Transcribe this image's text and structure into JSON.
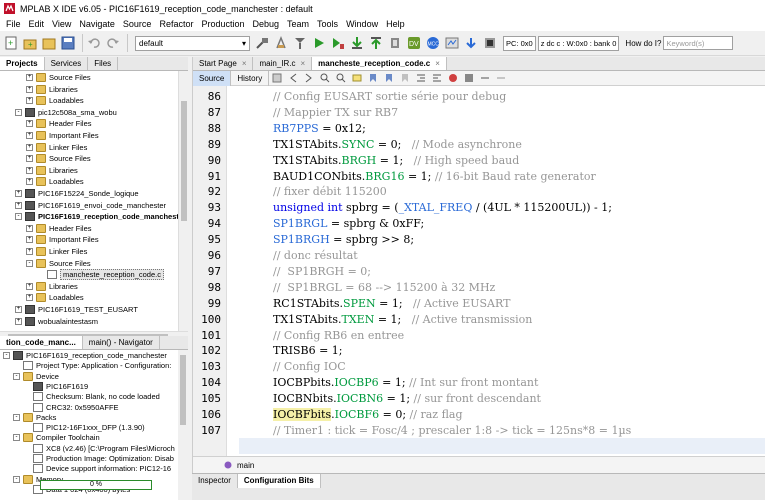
{
  "window": {
    "title": "MPLAB X IDE v6.05 - PIC16F1619_reception_code_manchester : default"
  },
  "menu": [
    "File",
    "Edit",
    "View",
    "Navigate",
    "Source",
    "Refactor",
    "Production",
    "Debug",
    "Team",
    "Tools",
    "Window",
    "Help"
  ],
  "toolbar": {
    "config_value": "default",
    "pc_status": "PC: 0x0",
    "bank_status": "z dc c  : W:0x0 : bank 0",
    "help_label": "How do I?",
    "keyword_placeholder": "Keyword(s)"
  },
  "left_tabs": [
    "Projects",
    "Services",
    "Files"
  ],
  "project_tree": [
    {
      "label": "Source Files",
      "indent": 2,
      "icon": "folder",
      "exp": "+"
    },
    {
      "label": "Libraries",
      "indent": 2,
      "icon": "folder",
      "exp": "+"
    },
    {
      "label": "Loadables",
      "indent": 2,
      "icon": "folder",
      "exp": "+"
    },
    {
      "label": "pic12c508a_sma_wobu",
      "indent": 1,
      "icon": "chip",
      "exp": "-"
    },
    {
      "label": "Header Files",
      "indent": 2,
      "icon": "folder",
      "exp": "+"
    },
    {
      "label": "Important Files",
      "indent": 2,
      "icon": "folder",
      "exp": "+"
    },
    {
      "label": "Linker Files",
      "indent": 2,
      "icon": "folder",
      "exp": "+"
    },
    {
      "label": "Source Files",
      "indent": 2,
      "icon": "folder",
      "exp": "+"
    },
    {
      "label": "Libraries",
      "indent": 2,
      "icon": "folder",
      "exp": "+"
    },
    {
      "label": "Loadables",
      "indent": 2,
      "icon": "folder",
      "exp": "+"
    },
    {
      "label": "PIC16F15224_Sonde_logique",
      "indent": 1,
      "icon": "chip",
      "exp": "+"
    },
    {
      "label": "PIC16F1619_envoi_code_manchester",
      "indent": 1,
      "icon": "chip",
      "exp": "+"
    },
    {
      "label": "PIC16F1619_reception_code_manchester",
      "indent": 1,
      "icon": "chip",
      "exp": "-",
      "bold": true
    },
    {
      "label": "Header Files",
      "indent": 2,
      "icon": "folder",
      "exp": "+"
    },
    {
      "label": "Important Files",
      "indent": 2,
      "icon": "folder",
      "exp": "+"
    },
    {
      "label": "Linker Files",
      "indent": 2,
      "icon": "folder",
      "exp": "+"
    },
    {
      "label": "Source Files",
      "indent": 2,
      "icon": "folder",
      "exp": "-"
    },
    {
      "label": "mancheste_reception_code.c",
      "indent": 3,
      "icon": "file",
      "exp": "",
      "selected": true
    },
    {
      "label": "Libraries",
      "indent": 2,
      "icon": "folder",
      "exp": "+"
    },
    {
      "label": "Loadables",
      "indent": 2,
      "icon": "folder",
      "exp": "+"
    },
    {
      "label": "PIC16F1619_TEST_EUSART",
      "indent": 1,
      "icon": "chip",
      "exp": "+"
    },
    {
      "label": "wobualaintestasm",
      "indent": 1,
      "icon": "chip",
      "exp": "+"
    }
  ],
  "nav_tabs": [
    "tion_code_manc...",
    "main() - Navigator"
  ],
  "nav_tree": [
    {
      "label": "PIC16F1619_reception_code_manchester",
      "indent": 0,
      "exp": "-",
      "icon": "chip"
    },
    {
      "label": "Project Type: Application - Configuration:",
      "indent": 1,
      "exp": "",
      "icon": "file"
    },
    {
      "label": "Device",
      "indent": 1,
      "exp": "-",
      "icon": "folder"
    },
    {
      "label": "PIC16F1619",
      "indent": 2,
      "exp": "",
      "icon": "chip"
    },
    {
      "label": "Checksum: Blank, no code loaded",
      "indent": 2,
      "exp": "",
      "icon": "file"
    },
    {
      "label": "CRC32: 0x5950AFFE",
      "indent": 2,
      "exp": "",
      "icon": "file"
    },
    {
      "label": "Packs",
      "indent": 1,
      "exp": "-",
      "icon": "folder"
    },
    {
      "label": "PIC12-16F1xxx_DFP (1.3.90)",
      "indent": 2,
      "exp": "",
      "icon": "file"
    },
    {
      "label": "Compiler Toolchain",
      "indent": 1,
      "exp": "-",
      "icon": "folder"
    },
    {
      "label": "XC8 (v2.46) [C:\\Program Files\\Microch",
      "indent": 2,
      "exp": "",
      "icon": "file"
    },
    {
      "label": "Production Image: Optimization: Disab",
      "indent": 2,
      "exp": "",
      "icon": "file"
    },
    {
      "label": "Device support information: PIC12-16",
      "indent": 2,
      "exp": "",
      "icon": "file"
    },
    {
      "label": "Memory",
      "indent": 1,
      "exp": "-",
      "icon": "folder"
    },
    {
      "label": "Data 1 024 (0x400) bytes",
      "indent": 2,
      "exp": "",
      "icon": "file"
    }
  ],
  "memory_usage": {
    "label": "0 %",
    "fraction": 0.0
  },
  "editor_tabs": [
    "Start Page",
    "main_IR.c",
    "mancheste_reception_code.c"
  ],
  "editor_toolbar": {
    "source": "Source",
    "history": "History"
  },
  "code_lines": [
    {
      "n": "86",
      "parts": [
        [
          "cm",
          "// Config EUSART sortie série pour debug"
        ]
      ]
    },
    {
      "n": "87",
      "parts": [
        [
          "cm",
          "// Mappier TX sur RB7"
        ]
      ]
    },
    {
      "n": "88",
      "parts": [
        [
          "mac",
          "RB7PPS"
        ],
        [
          "",
          " = 0x12;"
        ]
      ]
    },
    {
      "n": "89",
      "parts": [
        [
          "",
          "TX1STAbits."
        ],
        [
          "fld",
          "SYNC"
        ],
        [
          "",
          " = 0;   "
        ],
        [
          "cm",
          "// Mode asynchrone"
        ]
      ]
    },
    {
      "n": "90",
      "parts": [
        [
          "",
          "TX1STAbits."
        ],
        [
          "fld",
          "BRGH"
        ],
        [
          "",
          " = 1;   "
        ],
        [
          "cm",
          "// High speed baud"
        ]
      ]
    },
    {
      "n": "91",
      "parts": [
        [
          "",
          "BAUD1CONbits."
        ],
        [
          "fld",
          "BRG16"
        ],
        [
          "",
          " = 1; "
        ],
        [
          "cm",
          "// 16-bit Baud rate generator"
        ]
      ]
    },
    {
      "n": "92",
      "parts": [
        [
          "cm",
          "// fixer débit 115200"
        ]
      ]
    },
    {
      "n": "93",
      "parts": [
        [
          "kw",
          "unsigned int"
        ],
        [
          "",
          " spbrg = ("
        ],
        [
          "mac",
          "_XTAL_FREQ"
        ],
        [
          "",
          " / (4UL * 115200UL)) - 1;"
        ]
      ]
    },
    {
      "n": "94",
      "parts": [
        [
          "mac",
          "SP1BRGL"
        ],
        [
          "",
          " = spbrg & 0xFF;"
        ]
      ]
    },
    {
      "n": "95",
      "parts": [
        [
          "mac",
          "SP1BRGH"
        ],
        [
          "",
          " = spbrg >> 8;"
        ]
      ]
    },
    {
      "n": "96",
      "parts": [
        [
          "cm",
          "// donc résultat"
        ]
      ]
    },
    {
      "n": "97",
      "parts": [
        [
          "cm",
          "//  SP1BRGH = 0;"
        ]
      ]
    },
    {
      "n": "98",
      "parts": [
        [
          "cm",
          "//  SP1BRGL = 68 --> 115200 à 32 MHz"
        ]
      ]
    },
    {
      "n": "99",
      "parts": [
        [
          "",
          "RC1STAbits."
        ],
        [
          "fld",
          "SPEN"
        ],
        [
          "",
          " = 1;   "
        ],
        [
          "cm",
          "// Active EUSART"
        ]
      ]
    },
    {
      "n": "100",
      "parts": [
        [
          "",
          "TX1STAbits."
        ],
        [
          "fld",
          "TXEN"
        ],
        [
          "",
          " = 1;   "
        ],
        [
          "cm",
          "// Active transmission"
        ]
      ]
    },
    {
      "n": "101",
      "parts": [
        [
          "cm",
          "// Config RB6 en entree"
        ]
      ]
    },
    {
      "n": "102",
      "parts": [
        [
          "",
          "TRISB6 = 1;"
        ]
      ]
    },
    {
      "n": "103",
      "parts": [
        [
          "cm",
          "// Config IOC"
        ]
      ]
    },
    {
      "n": "104",
      "parts": [
        [
          "",
          "IOCBPbits."
        ],
        [
          "fld",
          "IOCBP6"
        ],
        [
          "",
          " = 1; "
        ],
        [
          "cm",
          "// Int sur front montant"
        ]
      ]
    },
    {
      "n": "105",
      "parts": [
        [
          "",
          "IOCBNbits."
        ],
        [
          "fld",
          "IOCBN6"
        ],
        [
          "",
          " = 1; "
        ],
        [
          "cm",
          "// sur front descendant"
        ]
      ]
    },
    {
      "n": "106",
      "parts": [
        [
          "hl",
          "IOCBFbits"
        ],
        [
          "",
          "."
        ],
        [
          "fld",
          "IOCBF6"
        ],
        [
          "",
          " = 0; "
        ],
        [
          "cm",
          "// raz flag"
        ]
      ]
    },
    {
      "n": "107",
      "parts": [
        [
          "cm",
          "// Timer1 : tick = Fosc/4 ; prescaler 1:8 -> tick = 125ns*8 = 1µs"
        ]
      ]
    }
  ],
  "breadcrumb": "main",
  "bottom_tabs": [
    "Inspector",
    "Configuration Bits"
  ]
}
